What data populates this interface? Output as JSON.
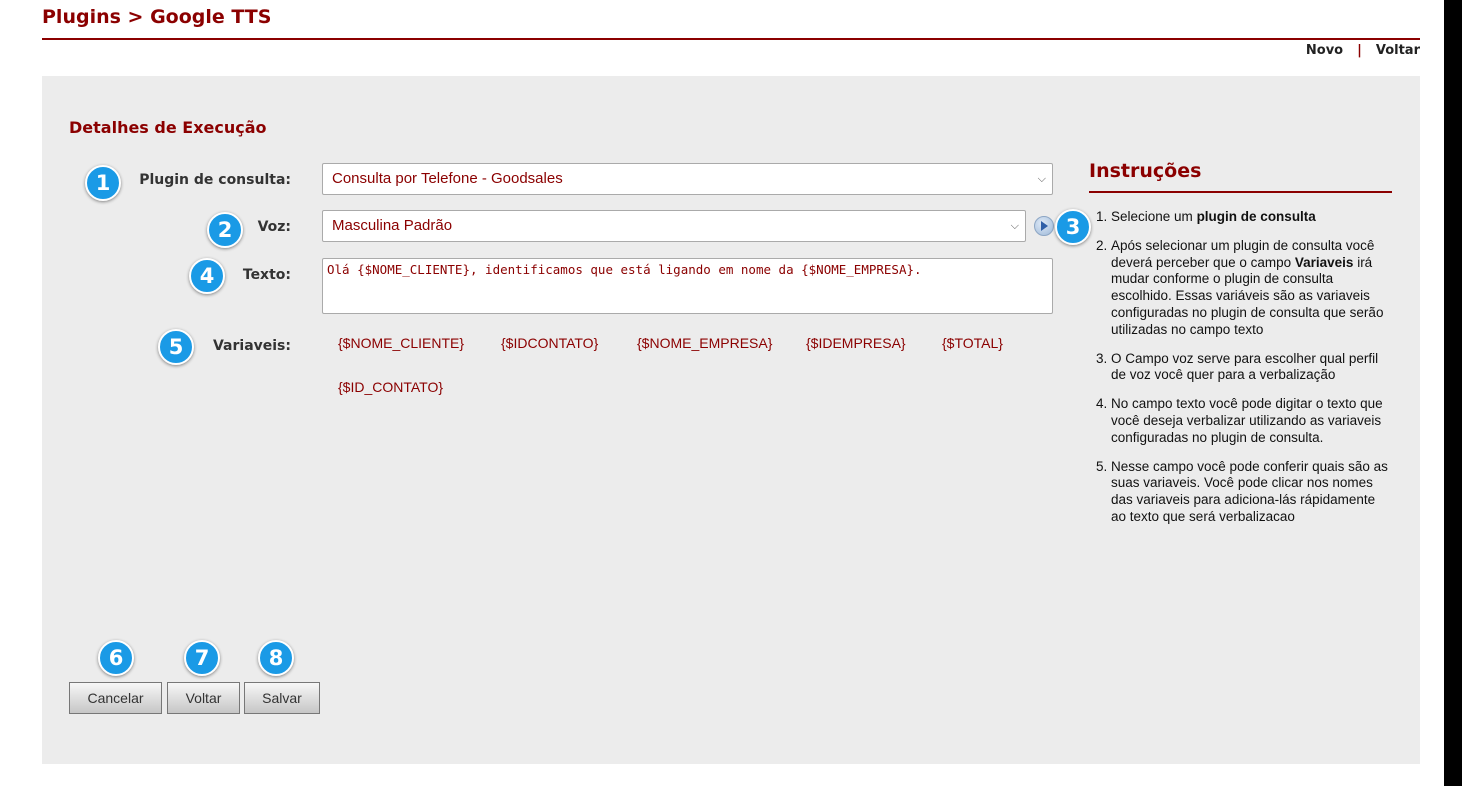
{
  "header": {
    "title": "Plugins > Google TTS",
    "links": {
      "novo": "Novo",
      "separator": "|",
      "voltar": "Voltar"
    }
  },
  "section_title": "Detalhes de Execução",
  "form": {
    "plugin_label": "Plugin de consulta:",
    "plugin_value": "Consulta por Telefone - Goodsales",
    "voz_label": "Voz:",
    "voz_value": "Masculina Padrão",
    "texto_label": "Texto:",
    "texto_value": "Olá {$NOME_CLIENTE}, identificamos que está ligando em nome da {$NOME_EMPRESA}.",
    "variaveis_label": "Variaveis:",
    "variaveis": [
      "{$NOME_CLIENTE}",
      "{$IDCONTATO}",
      "{$NOME_EMPRESA}",
      "{$IDEMPRESA}",
      "{$TOTAL}",
      "{$ID_CONTATO}"
    ]
  },
  "badges": [
    "1",
    "2",
    "3",
    "4",
    "5",
    "6",
    "7",
    "8"
  ],
  "instructions": {
    "title": "Instruções",
    "items": [
      {
        "before": "Selecione um ",
        "bold": "plugin de consulta",
        "after": ""
      },
      {
        "before": "Após selecionar um plugin de consulta você deverá perceber que o campo ",
        "bold": "Variaveis",
        "after": " irá mudar conforme o plugin de consulta escolhido. Essas variáveis são as variaveis configuradas no plugin de consulta que serão utilizadas no campo texto"
      },
      {
        "before": "O Campo voz serve para escolher qual perfil de voz você quer para a verbalização",
        "bold": "",
        "after": ""
      },
      {
        "before": "No campo texto você pode digitar o texto que você deseja verbalizar utilizando as variaveis configuradas no plugin de consulta.",
        "bold": "",
        "after": ""
      },
      {
        "before": "Nesse campo você pode conferir quais são as suas variaveis. Você pode clicar nos nomes das variaveis para adiciona-lás rápidamente ao texto que será verbalizacao",
        "bold": "",
        "after": ""
      }
    ]
  },
  "buttons": {
    "cancelar": "Cancelar",
    "voltar": "Voltar",
    "salvar": "Salvar"
  },
  "colors": {
    "brand": "#8b0000",
    "badge": "#1a9ae6",
    "panel": "#ececec"
  }
}
